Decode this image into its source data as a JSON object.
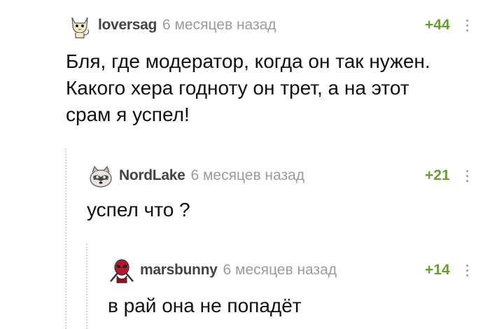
{
  "comments": [
    {
      "author": "loversag",
      "time": "6 месяцев назад",
      "rating": "+44",
      "text": "Бля, где модератор, когда он так нужен.\nКакого хера годноту он трет, а на этот\nсрам я успел!",
      "avatar": "cat-avatar-icon"
    },
    {
      "author": "NordLake",
      "time": "6 месяцев назад",
      "rating": "+21",
      "text": "успел что ?",
      "avatar": "raccoon-avatar-icon"
    },
    {
      "author": "marsbunny",
      "time": "6 месяцев назад",
      "rating": "+14",
      "text": "в рай она не попадёт",
      "avatar": "deadpool-avatar-icon"
    }
  ],
  "colors": {
    "rating": "#6b9a3b",
    "author": "#444444",
    "time": "#9b9b9b",
    "thread_line": "#d6d6d6"
  }
}
